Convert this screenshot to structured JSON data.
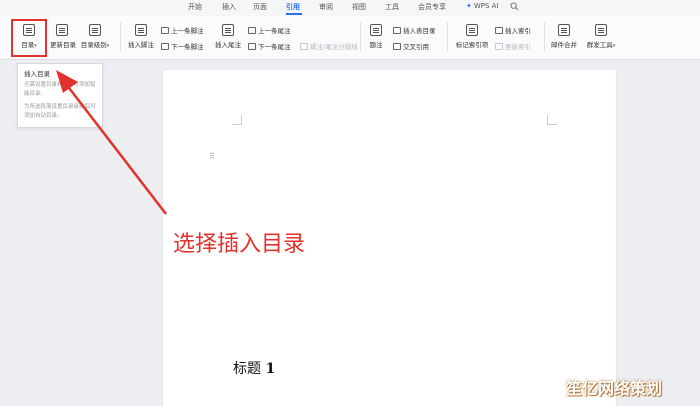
{
  "menu": {
    "tabs": [
      "开始",
      "插入",
      "页面",
      "引用",
      "审阅",
      "视图",
      "工具",
      "会员专享"
    ],
    "active_tab": "引用",
    "wps_ai": "WPS AI"
  },
  "ribbon": {
    "toc": "目录",
    "update_toc": "更新目录",
    "toc_level": "目录级别",
    "insert_footnote": "插入脚注",
    "prev_footnote": "上一条脚注",
    "next_footnote": "下一条脚注",
    "insert_endnote": "插入尾注",
    "prev_endnote": "上一条尾注",
    "next_endnote": "下一条尾注",
    "footnote_endnote_sep": "脚注/尾注分隔线",
    "caption": "题注",
    "insert_table_of_figures": "插入表目录",
    "cross_reference": "交叉引用",
    "mark_index_entry": "标记索引项",
    "insert_index": "插入索引",
    "update_index": "更新索引",
    "mail_merge": "邮件合并",
    "group_tools": "群发工具"
  },
  "dropdown": {
    "title": "插入目录",
    "desc1": "无需设置目录样式，可添加智能目录。",
    "desc2": "为所选段落设置目录级别后可添加自动目录。"
  },
  "document": {
    "heading_text": "标题",
    "heading_num": "1"
  },
  "annotation": "选择插入目录",
  "watermark": "笙亿网络策划",
  "colors": {
    "accent": "#2b6ef5",
    "annotation_red": "#e3322b"
  }
}
